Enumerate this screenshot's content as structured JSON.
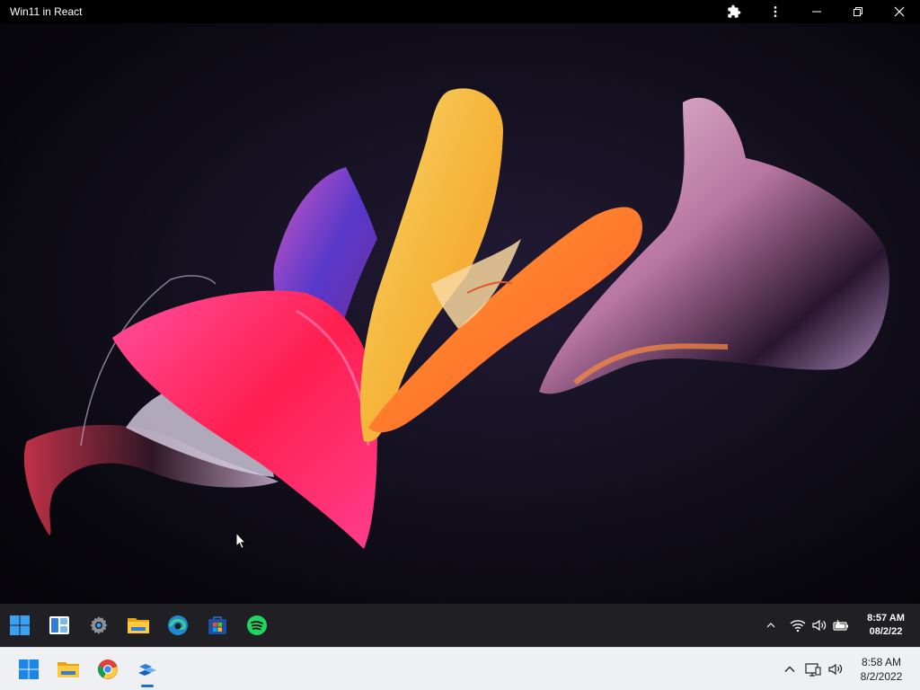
{
  "window": {
    "title": "Win11 in React",
    "controls": [
      "extensions-icon",
      "more-vert-icon",
      "minimize-icon",
      "restore-icon",
      "close-icon"
    ]
  },
  "desktop": {
    "wallpaper": "Windows 11 Bloom wallpaper (dark)",
    "accent_colors": [
      "#ff2f6d",
      "#f7b93a",
      "#ff7a2a",
      "#7a4cff",
      "#f7c0d6"
    ]
  },
  "inner_taskbar": {
    "apps": [
      {
        "name": "start",
        "icon": "windows-logo-icon"
      },
      {
        "name": "widgets",
        "icon": "widgets-icon"
      },
      {
        "name": "settings",
        "icon": "gear-icon"
      },
      {
        "name": "file-explorer",
        "icon": "folder-icon"
      },
      {
        "name": "edge",
        "icon": "edge-icon"
      },
      {
        "name": "store",
        "icon": "store-icon"
      },
      {
        "name": "spotify",
        "icon": "spotify-icon"
      }
    ],
    "tray": {
      "icons": [
        "chevron-up-icon",
        "wifi-icon",
        "volume-icon",
        "battery-icon"
      ],
      "time": "8:57 AM",
      "date": "08/2/22"
    }
  },
  "host_taskbar": {
    "apps": [
      {
        "name": "start",
        "icon": "windows-logo-icon"
      },
      {
        "name": "file-explorer",
        "icon": "folder-icon"
      },
      {
        "name": "chrome",
        "icon": "chrome-icon"
      },
      {
        "name": "win11-react-app",
        "icon": "app-icon",
        "active": true
      }
    ],
    "tray": {
      "icons": [
        "chevron-up-icon",
        "network-icon",
        "volume-icon"
      ],
      "time": "8:58 AM",
      "date": "8/2/2022"
    }
  }
}
